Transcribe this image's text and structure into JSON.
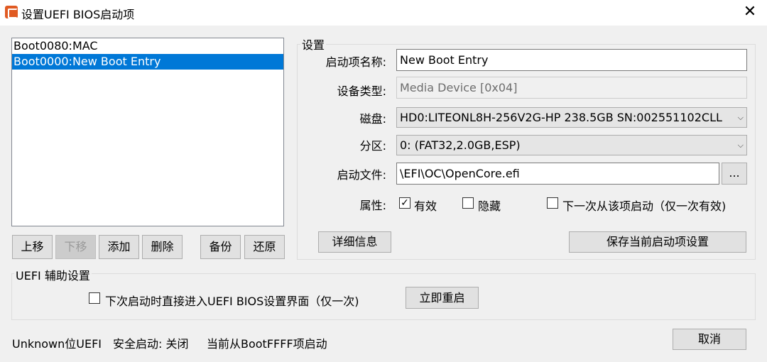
{
  "window": {
    "title": "设置UEFI BIOS启动项",
    "close_glyph": "✕"
  },
  "boot_list": {
    "items": [
      {
        "label": "Boot0080:MAC",
        "selected": false
      },
      {
        "label": "Boot0000:New Boot Entry",
        "selected": true
      }
    ]
  },
  "list_buttons": {
    "move_up": "上移",
    "move_down": "下移",
    "add": "添加",
    "delete": "删除",
    "backup": "备份",
    "restore": "还原"
  },
  "settings": {
    "group_title": "设置",
    "name_label": "启动项名称:",
    "name_value": "New Boot Entry",
    "device_type_label": "设备类型:",
    "device_type_value": "Media Device [0x04]",
    "disk_label": "磁盘:",
    "disk_value": "HD0:LITEONL8H-256V2G-HP 238.5GB SN:002551102CLL",
    "partition_label": "分区:",
    "partition_value": "0: (FAT32,2.0GB,ESP)",
    "boot_file_label": "启动文件:",
    "boot_file_value": "\\EFI\\OC\\OpenCore.efi",
    "browse_label": "...",
    "attributes_label": "属性:",
    "attr_active": {
      "label": "有效",
      "checked": true
    },
    "attr_hidden": {
      "label": "隐藏",
      "checked": false
    },
    "attr_next_boot": {
      "label": "下一次从该项启动（仅一次有效)",
      "checked": false
    },
    "details_button": "详细信息",
    "save_button": "保存当前启动项设置"
  },
  "uefi_helper": {
    "group_title": "UEFI 辅助设置",
    "enter_bios_label": "下次启动时直接进入UEFI BIOS设置界面（仅一次)",
    "enter_bios_checked": false,
    "restart_button": "立即重启"
  },
  "status_bar": {
    "firmware": "Unknown位UEFI",
    "secure_boot": "安全启动: 关闭",
    "current_boot": "当前从BootFFFF项启动",
    "cancel_button": "取消"
  },
  "icons": {
    "check": "✓",
    "dropdown": "⌵"
  }
}
